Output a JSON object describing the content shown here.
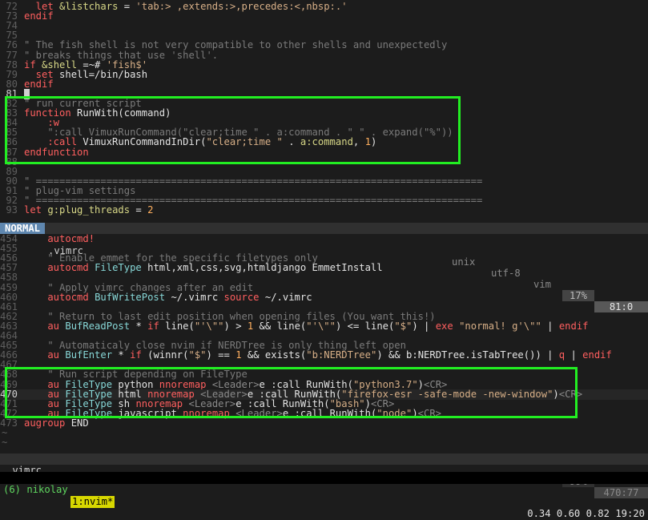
{
  "top_pane": {
    "lines": [
      {
        "n": "72",
        "segs": [
          {
            "c": "k",
            "t": "  let "
          },
          {
            "c": "v",
            "t": "&listchars"
          },
          {
            "c": "w",
            "t": " = "
          },
          {
            "c": "s",
            "t": "'tab:> ,extends:>,precedes:<,nbsp:.'"
          }
        ]
      },
      {
        "n": "73",
        "segs": [
          {
            "c": "k",
            "t": "endif"
          }
        ]
      },
      {
        "n": "74",
        "segs": []
      },
      {
        "n": "75",
        "segs": []
      },
      {
        "n": "76",
        "segs": [
          {
            "c": "c",
            "t": "\" The fish shell is not very compatible to other shells and unexpectedly"
          }
        ]
      },
      {
        "n": "77",
        "segs": [
          {
            "c": "c",
            "t": "\" breaks things that use 'shell'."
          }
        ]
      },
      {
        "n": "78",
        "segs": [
          {
            "c": "k",
            "t": "if "
          },
          {
            "c": "v",
            "t": "&shell"
          },
          {
            "c": "w",
            "t": " =~# "
          },
          {
            "c": "s",
            "t": "'fish$'"
          }
        ]
      },
      {
        "n": "79",
        "segs": [
          {
            "c": "k",
            "t": "  set "
          },
          {
            "c": "w",
            "t": "shell=/bin/bash"
          }
        ]
      },
      {
        "n": "80",
        "segs": [
          {
            "c": "k",
            "t": "endif"
          }
        ]
      },
      {
        "n": "81",
        "cur": true,
        "cursor": true,
        "segs": []
      },
      {
        "n": "82",
        "segs": [
          {
            "c": "c",
            "t": "\" run current script"
          }
        ]
      },
      {
        "n": "83",
        "segs": [
          {
            "c": "k",
            "t": "function "
          },
          {
            "c": "w",
            "t": "RunWith(command)"
          }
        ]
      },
      {
        "n": "84",
        "segs": [
          {
            "c": "k",
            "t": "    :w"
          }
        ]
      },
      {
        "n": "85",
        "segs": [
          {
            "c": "c",
            "t": "    \":call VimuxRunCommand(\"clear;time \" . a:command . \" \" . expand(\"%\"))"
          }
        ]
      },
      {
        "n": "86",
        "segs": [
          {
            "c": "k",
            "t": "    :call "
          },
          {
            "c": "w",
            "t": "VimuxRunCommandInDir("
          },
          {
            "c": "s",
            "t": "\"clear;time \""
          },
          {
            "c": "w",
            "t": " . "
          },
          {
            "c": "v",
            "t": "a:command"
          },
          {
            "c": "w",
            "t": ", "
          },
          {
            "c": "n",
            "t": "1"
          },
          {
            "c": "w",
            "t": ")"
          }
        ]
      },
      {
        "n": "87",
        "segs": [
          {
            "c": "k",
            "t": "endfunction"
          }
        ]
      },
      {
        "n": "88",
        "segs": []
      },
      {
        "n": "89",
        "segs": []
      },
      {
        "n": "90",
        "segs": [
          {
            "c": "c",
            "t": "\" ============================================================================"
          }
        ]
      },
      {
        "n": "91",
        "segs": [
          {
            "c": "c",
            "t": "\" plug-vim settings"
          }
        ]
      },
      {
        "n": "92",
        "segs": [
          {
            "c": "c",
            "t": "\" ============================================================================"
          }
        ]
      },
      {
        "n": "93",
        "segs": [
          {
            "c": "k",
            "t": "let "
          },
          {
            "c": "v",
            "t": "g:plug_threads"
          },
          {
            "c": "w",
            "t": " = "
          },
          {
            "c": "n",
            "t": "2"
          }
        ]
      }
    ]
  },
  "status_top": {
    "mode": "NORMAL",
    "file": ".vimrc",
    "fileformat": "unix",
    "encoding": "utf-8",
    "filetype": "vim",
    "percent": "17%",
    "position": "81:0"
  },
  "bottom_pane": {
    "lines": [
      {
        "n": "454",
        "segs": [
          {
            "c": "k",
            "t": "    autocmd!"
          }
        ]
      },
      {
        "n": "455",
        "segs": []
      },
      {
        "n": "456",
        "segs": [
          {
            "c": "c",
            "t": "    \" Enable emmet for the specific filetypes only"
          }
        ]
      },
      {
        "n": "457",
        "segs": [
          {
            "c": "k",
            "t": "    autocmd "
          },
          {
            "c": "g",
            "t": "FileType "
          },
          {
            "c": "w",
            "t": "html,xml,css,svg,htmldjango EmmetInstall"
          }
        ]
      },
      {
        "n": "458",
        "segs": []
      },
      {
        "n": "459",
        "segs": [
          {
            "c": "c",
            "t": "    \" Apply vimrc changes after an edit"
          }
        ]
      },
      {
        "n": "460",
        "segs": [
          {
            "c": "k",
            "t": "    autocmd "
          },
          {
            "c": "g",
            "t": "BufWritePost "
          },
          {
            "c": "w",
            "t": "~/.vimrc "
          },
          {
            "c": "k",
            "t": "source "
          },
          {
            "c": "w",
            "t": "~/.vimrc"
          }
        ]
      },
      {
        "n": "461",
        "segs": []
      },
      {
        "n": "462",
        "segs": [
          {
            "c": "c",
            "t": "    \" Return to last edit position when opening files (You want this!)"
          }
        ]
      },
      {
        "n": "463",
        "segs": [
          {
            "c": "k",
            "t": "    au "
          },
          {
            "c": "g",
            "t": "BufReadPost "
          },
          {
            "c": "w",
            "t": "* "
          },
          {
            "c": "k",
            "t": "if "
          },
          {
            "c": "w",
            "t": "line("
          },
          {
            "c": "s",
            "t": "\"'\\\"\""
          },
          {
            "c": "w",
            "t": ") > "
          },
          {
            "c": "n",
            "t": "1"
          },
          {
            "c": "w",
            "t": " && line("
          },
          {
            "c": "s",
            "t": "\"'\\\"\""
          },
          {
            "c": "w",
            "t": ") <= line("
          },
          {
            "c": "s",
            "t": "\"$\""
          },
          {
            "c": "w",
            "t": ") | "
          },
          {
            "c": "k",
            "t": "exe "
          },
          {
            "c": "s",
            "t": "\"normal! g'\\\"\""
          },
          {
            "c": "w",
            "t": " | "
          },
          {
            "c": "k",
            "t": "endif"
          }
        ]
      },
      {
        "n": "464",
        "segs": []
      },
      {
        "n": "465",
        "segs": [
          {
            "c": "c",
            "t": "    \" Automaticaly close nvim if NERDTree is only thing left open"
          }
        ]
      },
      {
        "n": "466",
        "segs": [
          {
            "c": "k",
            "t": "    au "
          },
          {
            "c": "g",
            "t": "BufEnter "
          },
          {
            "c": "w",
            "t": "* "
          },
          {
            "c": "k",
            "t": "if "
          },
          {
            "c": "w",
            "t": "(winnr("
          },
          {
            "c": "s",
            "t": "\"$\""
          },
          {
            "c": "w",
            "t": ") == "
          },
          {
            "c": "n",
            "t": "1"
          },
          {
            "c": "w",
            "t": " && exists("
          },
          {
            "c": "s",
            "t": "\"b:NERDTree\""
          },
          {
            "c": "w",
            "t": ") && b:NERDTree.isTabTree()) | "
          },
          {
            "c": "k",
            "t": "q"
          },
          {
            "c": "w",
            "t": " | "
          },
          {
            "c": "k",
            "t": "endif"
          }
        ]
      },
      {
        "n": "467",
        "segs": []
      },
      {
        "n": "468",
        "segs": [
          {
            "c": "c",
            "t": "    \" Run script depending on FileType"
          }
        ]
      },
      {
        "n": "469",
        "segs": [
          {
            "c": "k",
            "t": "    au "
          },
          {
            "c": "g",
            "t": "FileType "
          },
          {
            "c": "w",
            "t": "python "
          },
          {
            "c": "k",
            "t": "nnoremap "
          },
          {
            "c": "sp",
            "t": "<Leader>"
          },
          {
            "c": "w",
            "t": "e :call RunWith("
          },
          {
            "c": "s",
            "t": "\"python3.7\""
          },
          {
            "c": "w",
            "t": ")"
          },
          {
            "c": "sp",
            "t": "<CR>"
          }
        ]
      },
      {
        "n": "470",
        "cur": true,
        "cursorline": true,
        "segs": [
          {
            "c": "k",
            "t": "    au "
          },
          {
            "c": "g",
            "t": "FileType "
          },
          {
            "c": "w",
            "t": "html "
          },
          {
            "c": "k",
            "t": "nnoremap "
          },
          {
            "c": "sp",
            "t": "<Leader>"
          },
          {
            "c": "w",
            "t": "e :call RunWith("
          },
          {
            "c": "s",
            "t": "\"firefox-esr -safe-mode -new-window\""
          },
          {
            "c": "w",
            "t": ")"
          },
          {
            "c": "sp",
            "t": "<CR>"
          }
        ]
      },
      {
        "n": "471",
        "segs": [
          {
            "c": "k",
            "t": "    au "
          },
          {
            "c": "g",
            "t": "FileType "
          },
          {
            "c": "w",
            "t": "sh "
          },
          {
            "c": "k",
            "t": "nnoremap "
          },
          {
            "c": "sp",
            "t": "<Leader>"
          },
          {
            "c": "w",
            "t": "e :call RunWith("
          },
          {
            "c": "s",
            "t": "\"bash\""
          },
          {
            "c": "w",
            "t": ")"
          },
          {
            "c": "sp",
            "t": "<CR>"
          }
        ]
      },
      {
        "n": "472",
        "segs": [
          {
            "c": "k",
            "t": "    au "
          },
          {
            "c": "g",
            "t": "FileType "
          },
          {
            "c": "w",
            "t": "javascript "
          },
          {
            "c": "k",
            "t": "nnoremap "
          },
          {
            "c": "sp",
            "t": "<Leader>"
          },
          {
            "c": "w",
            "t": "e :call RunWith("
          },
          {
            "c": "s",
            "t": "\"node\""
          },
          {
            "c": "w",
            "t": ")"
          },
          {
            "c": "sp",
            "t": "<CR>"
          }
        ]
      },
      {
        "n": "473",
        "segs": [
          {
            "c": "k",
            "t": "augroup "
          },
          {
            "c": "w",
            "t": "END"
          }
        ]
      },
      {
        "n": "~",
        "tilde": true,
        "segs": []
      },
      {
        "n": "~",
        "tilde": true,
        "segs": []
      }
    ]
  },
  "status_bottom": {
    "file": ".vimrc",
    "percent": "99%",
    "position": "470:77"
  },
  "tmux": {
    "session": "(6) nikolay",
    "window": "1:nvim*",
    "load": "0.34 0.60 0.82",
    "time": "19:20"
  },
  "highlight_color": "#22ee22"
}
